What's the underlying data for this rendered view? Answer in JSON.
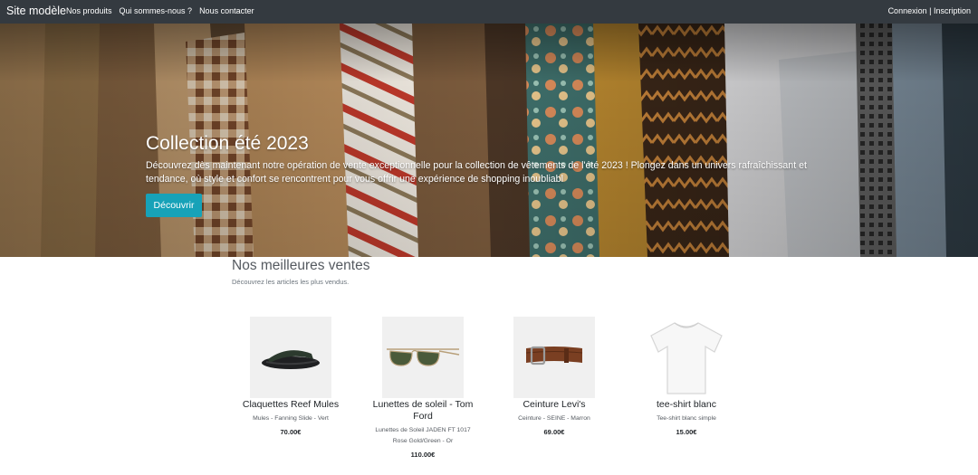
{
  "navbar": {
    "brand": "Site modèle",
    "links": [
      "Nos produits",
      "Qui sommes-nous ?",
      "Nous contacter"
    ],
    "login": "Connexion",
    "separator": "|",
    "signup": "Inscription"
  },
  "hero": {
    "title": "Collection été 2023",
    "text": "Découvrez dès maintenant notre opération de vente exceptionnelle pour la collection de vêtements de l'été 2023 ! Plongez dans un univers rafraîchissant et tendance, où style et confort se rencontrent pour vous offrir une expérience de shopping inoubliabl",
    "button": "Découvrir"
  },
  "best_sellers": {
    "title": "Nos meilleures ventes",
    "subtitle": "Découvrez les articles les plus vendus.",
    "products": [
      {
        "name": "Claquettes Reef Mules",
        "description": "Mules - Fanning Slide - Vert",
        "price": "70.00€",
        "icon": "sandal-icon"
      },
      {
        "name": "Lunettes de soleil - Tom Ford",
        "description": "Lunettes de Soleil JADEN FT 1017 Rose Gold/Green - Or",
        "price": "110.00€",
        "icon": "sunglasses-icon"
      },
      {
        "name": "Ceinture Levi's",
        "description": "Ceinture - SEINE - Marron",
        "price": "69.00€",
        "icon": "belt-icon"
      },
      {
        "name": "tee-shirt blanc",
        "description": "Tee-shirt blanc simple",
        "price": "15.00€",
        "icon": "tshirt-icon"
      }
    ]
  },
  "colors": {
    "navbar": "#343a40",
    "accent": "#17a2b8",
    "title": "#555a60"
  }
}
